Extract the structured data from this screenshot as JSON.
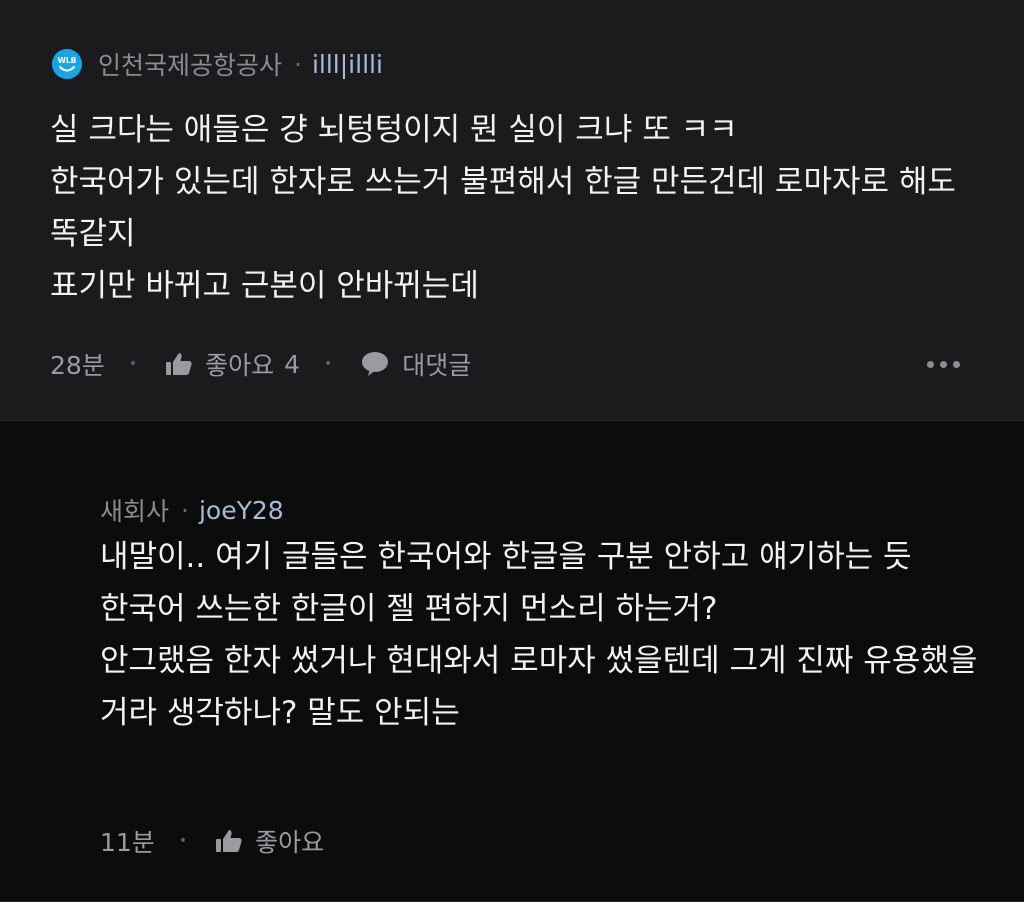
{
  "comment": {
    "company": "인천국제공항공사",
    "username": "illl|illli",
    "logo_text": "WLB",
    "body": "실 크다는 애들은 걍 뇌텅텅이지 뭔 실이 크냐 또 ㅋㅋ\n한국어가 있는데 한자로 쓰는거 불편해서 한글 만든건데 로마자로 해도 똑같지\n표기만 바뀌고 근본이 안바뀌는데",
    "time": "28분",
    "like_label": "좋아요",
    "like_count": "4",
    "reply_label": "대댓글",
    "icons": [
      "wlb-logo-icon",
      "thumbs-up-icon",
      "speech-bubble-icon",
      "more-horizontal-icon"
    ]
  },
  "reply": {
    "company": "새회사",
    "username": "joeY28",
    "body": "내말이.. 여기 글들은 한국어와 한글을 구분 안하고 얘기하는 듯\n한국어 쓰는한 한글이 젤 편하지 먼소리 하는거?\n안그랬음 한자 썼거나 현대와서 로마자 썼을텐데 그게 진짜 유용했을거라 생각하나? 말도 안되는",
    "time": "11분",
    "like_label": "좋아요",
    "icons": [
      "thumbs-up-icon"
    ]
  },
  "colors": {
    "comment_bg": "#1b1b1d",
    "reply_bg": "#0c0c0d",
    "username": "#a9b9d8",
    "logo": "#1aa4e4"
  }
}
